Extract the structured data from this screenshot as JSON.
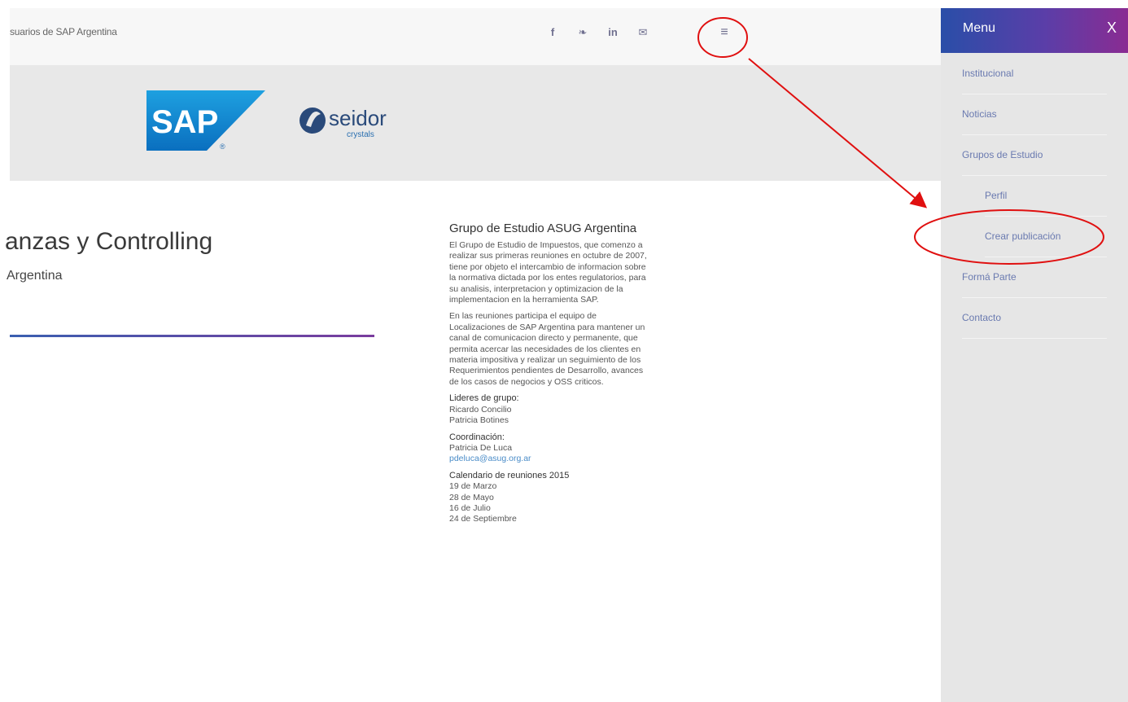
{
  "topbar": {
    "site_name": "suarios de SAP Argentina",
    "social": [
      {
        "icon": "facebook-icon",
        "glyph": "f"
      },
      {
        "icon": "twitter-icon",
        "glyph": "❧"
      },
      {
        "icon": "linkedin-icon",
        "glyph": "in"
      },
      {
        "icon": "email-icon",
        "glyph": "✉"
      }
    ],
    "menu_icon": "≡"
  },
  "banner": {
    "sap_logo": "SAP",
    "seidor_name": "seidor",
    "seidor_sub": "crystals"
  },
  "page": {
    "title": "anzas y Controlling",
    "subtitle": "Argentina"
  },
  "info": {
    "heading": "Grupo de Estudio ASUG Argentina",
    "para1": "El Grupo de Estudio de Impuestos, que comenzo a realizar sus primeras reuniones en octubre de 2007, tiene por objeto el intercambio de informacion sobre la normativa dictada por los entes regulatorios, para su analisis, interpretacion y optimizacion de la implementacion en la herramienta SAP.",
    "para2": "En las reuniones participa el equipo de Localizaciones de SAP Argentina para mantener un canal de comunicacion directo y permanente, que permita acercar las necesidades de los clientes en materia impositiva y realizar un seguimiento de los Requerimientos pendientes de Desarrollo, avances de los casos de negocios y OSS criticos.",
    "leaders_label": "Lideres de grupo:",
    "leader1": "Ricardo Concilio",
    "leader2": "Patricia Botines",
    "coord_label": "Coordinación:",
    "coord_name": "Patricia De Luca",
    "coord_email": "pdeluca@asug.org.ar",
    "calendar_label": "Calendario  de reuniones 2015",
    "dates": [
      "19 de Marzo",
      "28 de Mayo",
      "16 de Julio",
      "24 de Septiembre"
    ]
  },
  "sidebar": {
    "title": "Menu",
    "close": "X",
    "items": [
      {
        "label": "Institucional"
      },
      {
        "label": "Noticias"
      },
      {
        "label": "Grupos de Estudio"
      },
      {
        "label": "Perfil"
      },
      {
        "label": "Crear publicación"
      },
      {
        "label": "Formá Parte"
      },
      {
        "label": "Contacto"
      }
    ]
  },
  "colors": {
    "annotation": "#e01010",
    "menu_link": "#6a7ab0",
    "accent_blue": "#2a4ea8",
    "accent_purple": "#8a2c92"
  }
}
